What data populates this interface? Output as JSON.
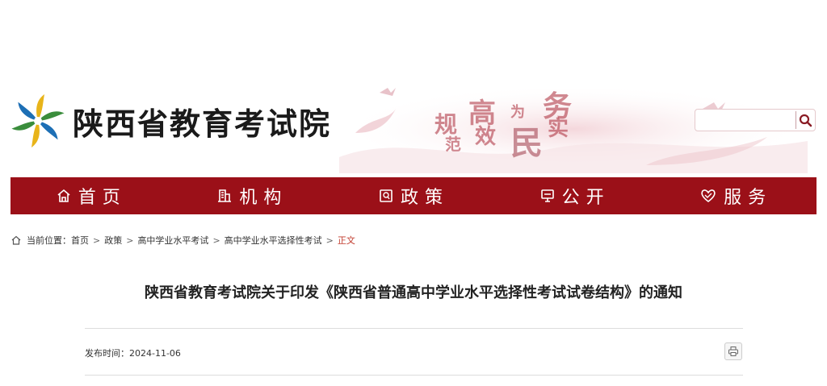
{
  "header": {
    "site_title": "陕西省教育考试院",
    "slogan": [
      "规",
      "范",
      "高",
      "效",
      "为",
      "民",
      "务",
      "实"
    ],
    "search": {
      "placeholder": "",
      "value": ""
    },
    "search_icon": "search-icon"
  },
  "nav": {
    "items": [
      {
        "label": "首页",
        "icon": "home-icon"
      },
      {
        "label": "机构",
        "icon": "building-icon"
      },
      {
        "label": "政策",
        "icon": "policy-icon"
      },
      {
        "label": "公开",
        "icon": "monitor-icon"
      },
      {
        "label": "服务",
        "icon": "service-heart-icon"
      }
    ],
    "bg_color": "#9b1018"
  },
  "breadcrumb": {
    "prefix": "当前位置：",
    "items": [
      "首页",
      "政策",
      "高中学业水平考试",
      "高中学业水平选择性考试"
    ],
    "separator": ">",
    "current": "正文",
    "current_color": "#c0392b"
  },
  "article": {
    "title": "陕西省教育考试院关于印发《陕西省普通高中学业水平选择性考试试卷结构》的通知",
    "publish_label": "发布时间：",
    "publish_date": "2024-11-06",
    "print_icon": "print-icon"
  }
}
